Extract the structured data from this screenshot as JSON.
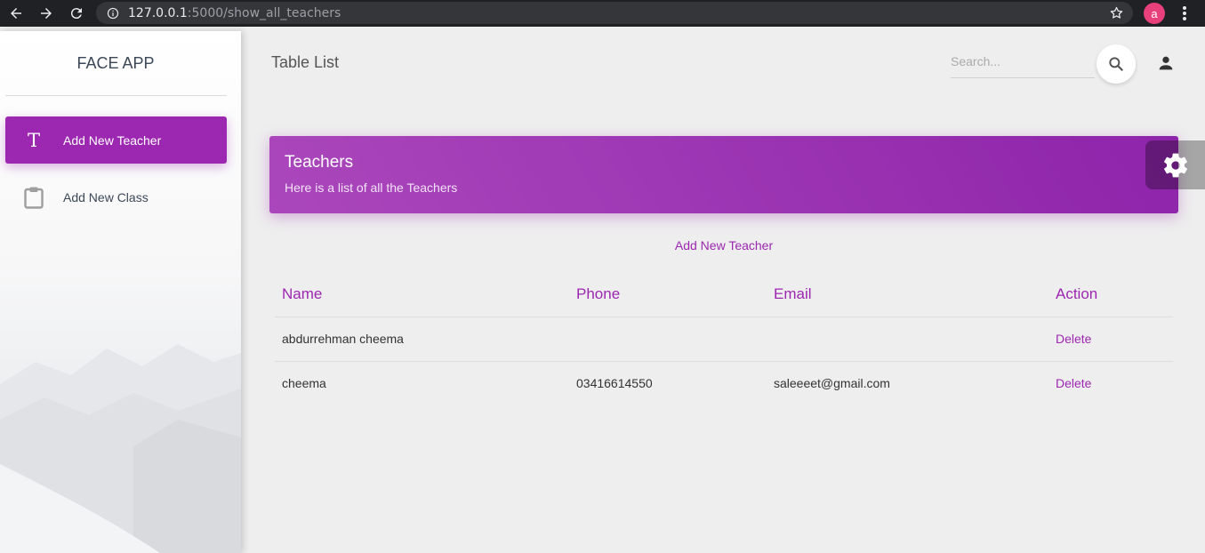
{
  "browser": {
    "url_host": "127.0.0.1",
    "url_path": ":5000/show_all_teachers",
    "profile_initial": "a"
  },
  "sidebar": {
    "brand": "FACE APP",
    "items": [
      {
        "label": "Add New Teacher",
        "icon": "letter-t-icon",
        "active": true
      },
      {
        "label": "Add New Class",
        "icon": "clipboard-icon",
        "active": false
      }
    ]
  },
  "header": {
    "title": "Table List",
    "search_placeholder": "Search..."
  },
  "card": {
    "title": "Teachers",
    "subtitle": "Here is a list of all the Teachers"
  },
  "add_link": "Add New Teacher",
  "table": {
    "columns": [
      "Name",
      "Phone",
      "Email",
      "Action"
    ],
    "rows": [
      {
        "name": "abdurrehman cheema",
        "phone": "",
        "email": "",
        "action": "Delete"
      },
      {
        "name": "cheema",
        "phone": "03416614550",
        "email": "saleeeet@gmail.com",
        "action": "Delete"
      }
    ]
  },
  "colors": {
    "accent": "#9c27b0",
    "background": "#eeeeee"
  }
}
